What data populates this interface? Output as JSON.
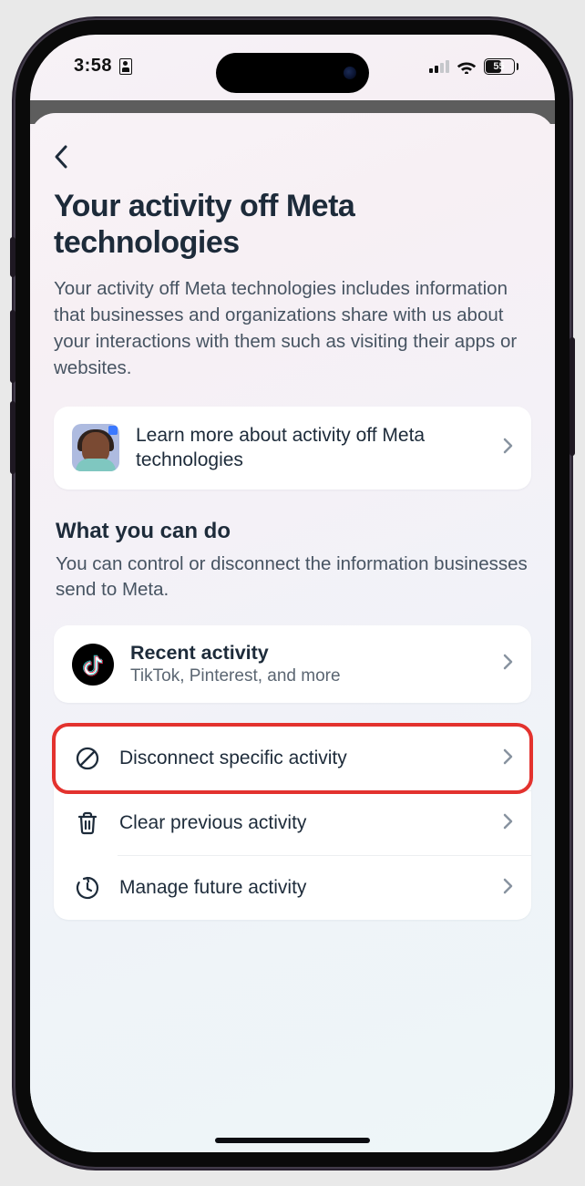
{
  "status": {
    "time": "3:58",
    "battery": "55"
  },
  "page": {
    "title": "Your activity off Meta technologies",
    "description": "Your activity off Meta technologies includes information that businesses and organizations share with us about your interactions with them such as visiting their apps or websites."
  },
  "learn_card": {
    "label": "Learn more about activity off Meta technologies"
  },
  "section": {
    "heading": "What you can do",
    "sub": "You can control or disconnect the information businesses send to Meta."
  },
  "recent": {
    "title": "Recent activity",
    "sub": "TikTok, Pinterest, and more"
  },
  "actions": {
    "disconnect": "Disconnect specific activity",
    "clear": "Clear previous activity",
    "manage": "Manage future activity"
  }
}
